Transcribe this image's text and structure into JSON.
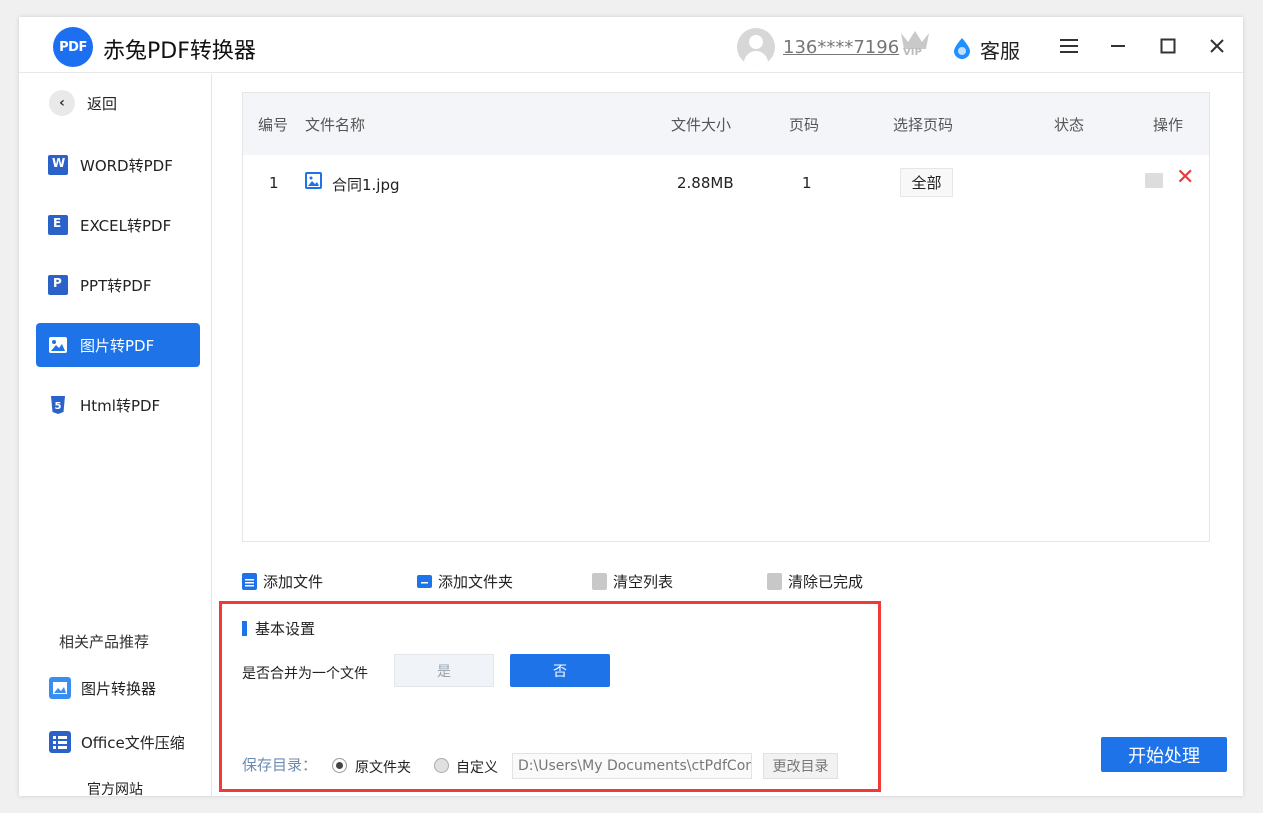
{
  "app": {
    "logo_text": "PDF",
    "title": "赤兔PDF转换器"
  },
  "header": {
    "phone": "136****7196",
    "vip_badge": "VIP",
    "service_label": "客服"
  },
  "sidebar": {
    "back_label": "返回",
    "items": [
      {
        "label": "WORD转PDF",
        "icon": "word-icon",
        "color": "#2b62c9"
      },
      {
        "label": "EXCEL转PDF",
        "icon": "excel-icon",
        "color": "#2b62c9"
      },
      {
        "label": "PPT转PDF",
        "icon": "ppt-icon",
        "color": "#2b62c9"
      },
      {
        "label": "图片转PDF",
        "icon": "image-icon",
        "active": true
      },
      {
        "label": "Html转PDF",
        "icon": "html5-icon",
        "color": "#2b62c9"
      }
    ],
    "recommend_title": "相关产品推荐",
    "recommend": [
      {
        "label": "图片转换器",
        "icon": "image-converter-icon"
      },
      {
        "label": "Office文件压缩",
        "icon": "office-compress-icon"
      }
    ],
    "official_site": "官方网站"
  },
  "table": {
    "headers": [
      "编号",
      "文件名称",
      "文件大小",
      "页码",
      "选择页码",
      "状态",
      "操作"
    ],
    "rows": [
      {
        "index": "1",
        "name": "合同1.jpg",
        "size": "2.88MB",
        "pages": "1",
        "page_select": "全部",
        "status": ""
      }
    ]
  },
  "actions": {
    "add_file": "添加文件",
    "add_folder": "添加文件夹",
    "clear_list": "清空列表",
    "clear_done": "清除已完成"
  },
  "settings": {
    "title": "基本设置",
    "merge_label": "是否合并为一个文件",
    "merge_yes": "是",
    "merge_no": "否",
    "merge_selected": "否",
    "save_label": "保存目录：",
    "option_original": "原文件夹",
    "option_custom": "自定义",
    "selected_option": "原文件夹",
    "path_value": "D:\\Users\\My Documents\\ctPdfCon",
    "change_dir": "更改目录"
  },
  "start_button": "开始处理",
  "colors": {
    "accent": "#1e73e8",
    "highlight_border": "#f03a3a",
    "delete": "#e83b3b"
  }
}
